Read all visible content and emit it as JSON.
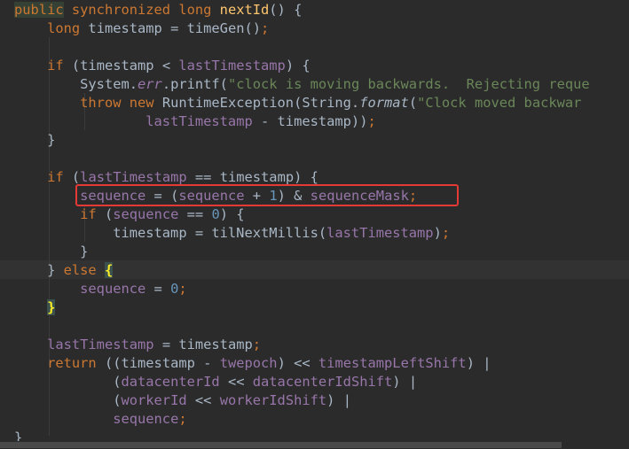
{
  "code_lines": [
    [
      {
        "t": "public",
        "c": "kw kw-hl"
      },
      {
        "t": " synchronized long ",
        "c": "kw"
      },
      {
        "t": "nextId",
        "c": "fn"
      },
      {
        "t": "() {",
        "c": ""
      }
    ],
    [
      {
        "t": "    ",
        "c": ""
      },
      {
        "t": "long ",
        "c": "kw"
      },
      {
        "t": "timestamp = timeGen()",
        "c": ""
      },
      {
        "t": ";",
        "c": "kw"
      }
    ],
    [],
    [
      {
        "t": "    ",
        "c": ""
      },
      {
        "t": "if ",
        "c": "kw"
      },
      {
        "t": "(timestamp < ",
        "c": ""
      },
      {
        "t": "lastTimestamp",
        "c": "fld"
      },
      {
        "t": ") {",
        "c": ""
      }
    ],
    [
      {
        "t": "        System.",
        "c": ""
      },
      {
        "t": "err",
        "c": "fld ital"
      },
      {
        "t": ".printf(",
        "c": ""
      },
      {
        "t": "\"clock is moving backwards.  Rejecting reque",
        "c": "str"
      }
    ],
    [
      {
        "t": "        ",
        "c": ""
      },
      {
        "t": "throw new ",
        "c": "kw"
      },
      {
        "t": "RuntimeException(String.",
        "c": ""
      },
      {
        "t": "format",
        "c": "ital"
      },
      {
        "t": "(",
        "c": ""
      },
      {
        "t": "\"Clock moved backwar",
        "c": "str"
      }
    ],
    [
      {
        "t": "                ",
        "c": ""
      },
      {
        "t": "lastTimestamp",
        "c": "fld"
      },
      {
        "t": " - timestamp))",
        "c": ""
      },
      {
        "t": ";",
        "c": "kw"
      }
    ],
    [
      {
        "t": "    }",
        "c": ""
      }
    ],
    [],
    [
      {
        "t": "    ",
        "c": ""
      },
      {
        "t": "if ",
        "c": "kw"
      },
      {
        "t": "(",
        "c": ""
      },
      {
        "t": "lastTimestamp",
        "c": "fld"
      },
      {
        "t": " == timestamp) {",
        "c": ""
      }
    ],
    [
      {
        "t": "        ",
        "c": ""
      },
      {
        "t": "sequence",
        "c": "fld"
      },
      {
        "t": " = (",
        "c": ""
      },
      {
        "t": "sequence",
        "c": "fld"
      },
      {
        "t": " + ",
        "c": ""
      },
      {
        "t": "1",
        "c": "num"
      },
      {
        "t": ") & ",
        "c": ""
      },
      {
        "t": "sequenceMask",
        "c": "fld"
      },
      {
        "t": ";",
        "c": "kw"
      }
    ],
    [
      {
        "t": "        ",
        "c": ""
      },
      {
        "t": "if ",
        "c": "kw"
      },
      {
        "t": "(",
        "c": ""
      },
      {
        "t": "sequence",
        "c": "fld"
      },
      {
        "t": " == ",
        "c": ""
      },
      {
        "t": "0",
        "c": "num"
      },
      {
        "t": ") {",
        "c": ""
      }
    ],
    [
      {
        "t": "            timestamp = tilNextMillis(",
        "c": ""
      },
      {
        "t": "lastTimestamp",
        "c": "fld"
      },
      {
        "t": ")",
        "c": ""
      },
      {
        "t": ";",
        "c": "kw"
      }
    ],
    [
      {
        "t": "        }",
        "c": ""
      }
    ],
    [
      {
        "t": "    } ",
        "c": ""
      },
      {
        "t": "else ",
        "c": "kw"
      },
      {
        "t": "{",
        "c": "brace-hl"
      }
    ],
    [
      {
        "t": "        ",
        "c": ""
      },
      {
        "t": "sequence",
        "c": "fld"
      },
      {
        "t": " = ",
        "c": ""
      },
      {
        "t": "0",
        "c": "num"
      },
      {
        "t": ";",
        "c": "kw"
      }
    ],
    [
      {
        "t": "    ",
        "c": ""
      },
      {
        "t": "}",
        "c": "brace-hl"
      }
    ],
    [],
    [
      {
        "t": "    ",
        "c": ""
      },
      {
        "t": "lastTimestamp",
        "c": "fld"
      },
      {
        "t": " = timestamp",
        "c": ""
      },
      {
        "t": ";",
        "c": "kw"
      }
    ],
    [
      {
        "t": "    ",
        "c": ""
      },
      {
        "t": "return ",
        "c": "kw"
      },
      {
        "t": "((timestamp - ",
        "c": ""
      },
      {
        "t": "twepoch",
        "c": "fld"
      },
      {
        "t": ") << ",
        "c": ""
      },
      {
        "t": "timestampLeftShift",
        "c": "fld"
      },
      {
        "t": ") |",
        "c": ""
      }
    ],
    [
      {
        "t": "            (",
        "c": ""
      },
      {
        "t": "datacenterId",
        "c": "fld"
      },
      {
        "t": " << ",
        "c": ""
      },
      {
        "t": "datacenterIdShift",
        "c": "fld"
      },
      {
        "t": ") |",
        "c": ""
      }
    ],
    [
      {
        "t": "            (",
        "c": ""
      },
      {
        "t": "workerId",
        "c": "fld"
      },
      {
        "t": " << ",
        "c": ""
      },
      {
        "t": "workerIdShift",
        "c": "fld"
      },
      {
        "t": ") |",
        "c": ""
      }
    ],
    [
      {
        "t": "            ",
        "c": ""
      },
      {
        "t": "sequence",
        "c": "fld"
      },
      {
        "t": ";",
        "c": "kw"
      }
    ],
    [
      {
        "t": "}",
        "c": ""
      }
    ]
  ],
  "colors": {
    "background": "#2b2b2b",
    "keyword": "#cc7832",
    "field": "#9876aa",
    "method": "#ffc66d",
    "string": "#6a8759",
    "number": "#6897bb",
    "plain": "#a9b7c6",
    "annotation_box": "#e53935"
  },
  "annotation": {
    "type": "red-rectangle",
    "target_line": 11
  }
}
